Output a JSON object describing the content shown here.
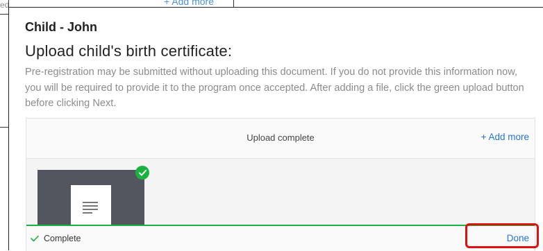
{
  "background": {
    "left_text": "ed",
    "top_link": "+ Add more"
  },
  "modal": {
    "child_label": "Child - John",
    "heading": "Upload child's birth certificate:",
    "description": "Pre-registration may be submitted without uploading this document. If you do not provide this information now, you will be required to provide it to the program once accepted. After adding a file, click the green upload button before clicking Next."
  },
  "uploader": {
    "status": "Upload complete",
    "add_more": "Add more",
    "add_more_icon": "plus-icon",
    "footer_status": "Complete",
    "done_label": "Done"
  },
  "colors": {
    "accent": "#2275d7",
    "success": "#1bb240",
    "highlight": "#e01010"
  }
}
